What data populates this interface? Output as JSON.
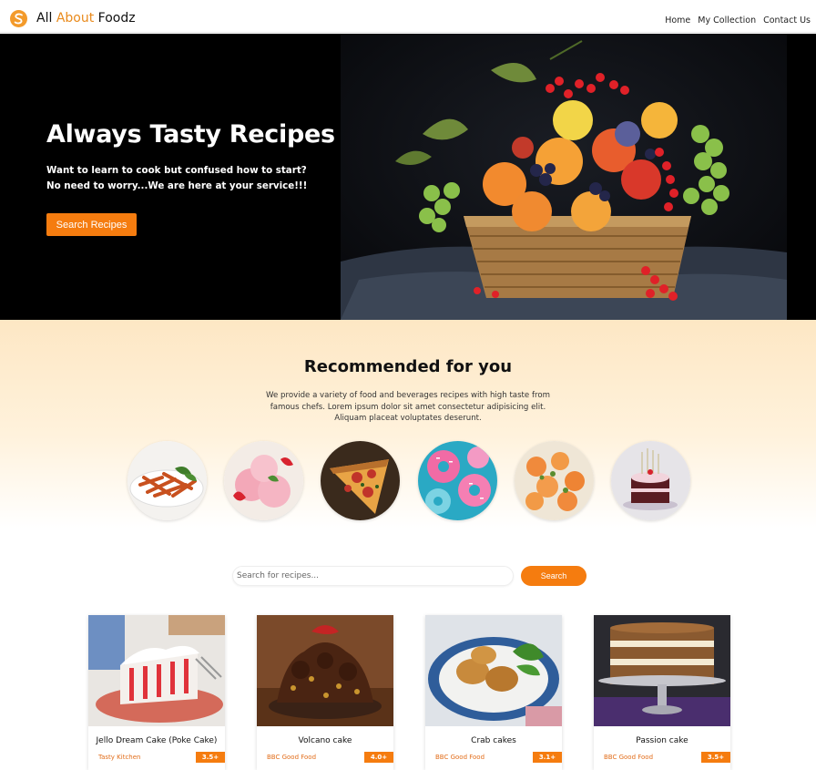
{
  "header": {
    "brand_part1": "All ",
    "brand_highlight": "About",
    "brand_part2": " Foodz",
    "nav": [
      "Home",
      "My Collection",
      "Contact Us"
    ]
  },
  "hero": {
    "title": "Always Tasty Recipes",
    "subtitle_line1": "Want to learn to cook but confused how to start?",
    "subtitle_line2": "No need to worry...We are here at your service!!!",
    "button": "Search Recipes"
  },
  "recommended": {
    "title": "Recommended for you",
    "description": "We provide a variety of food and beverages recipes with high taste from famous chefs. Lorem ipsum dolor sit amet consectetur adipisicing elit. Aliquam placeat voluptates deserunt.",
    "dishes": [
      "pasta",
      "strawberry ice cream",
      "pizza",
      "donuts",
      "shrimp dish",
      "birthday cake"
    ]
  },
  "search": {
    "placeholder": "Search for recipes...",
    "button": "Search"
  },
  "recipes": [
    {
      "title": "Jello Dream Cake (Poke Cake)",
      "source": "Tasty Kitchen",
      "rating": "3.5+"
    },
    {
      "title": "Volcano cake",
      "source": "BBC Good Food",
      "rating": "4.0+"
    },
    {
      "title": "Crab cakes",
      "source": "BBC Good Food",
      "rating": "3.1+"
    },
    {
      "title": "Passion cake",
      "source": "BBC Good Food",
      "rating": "3.5+"
    }
  ],
  "colors": {
    "accent": "#f57c0f",
    "brand_highlight": "#e98a1c",
    "hero_bg": "#000000",
    "section_bg": "#fde7c4"
  }
}
